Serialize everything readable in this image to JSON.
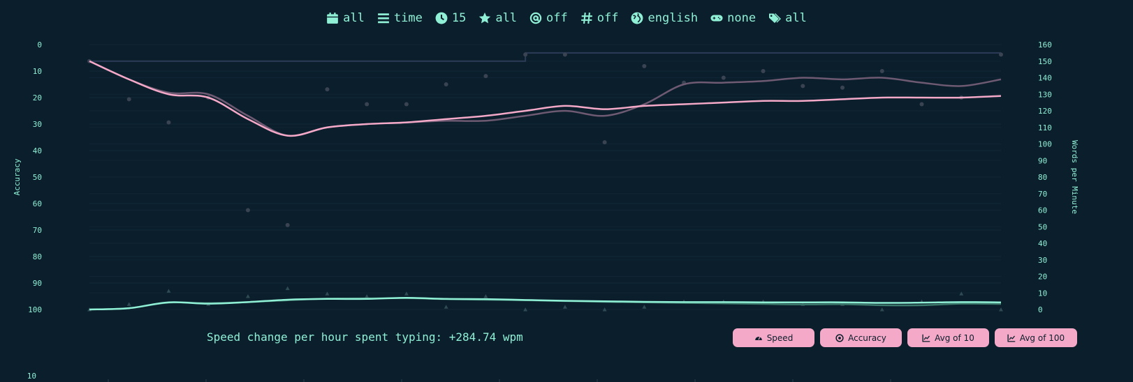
{
  "filters": [
    {
      "icon": "calendar-icon",
      "label": "all"
    },
    {
      "icon": "list-icon",
      "label": "time"
    },
    {
      "icon": "clock-icon",
      "label": "15"
    },
    {
      "icon": "star-icon",
      "label": "all"
    },
    {
      "icon": "at-icon",
      "label": "off"
    },
    {
      "icon": "hash-icon",
      "label": "off"
    },
    {
      "icon": "globe-icon",
      "label": "english"
    },
    {
      "icon": "gamepad-icon",
      "label": "none"
    },
    {
      "icon": "tags-icon",
      "label": "all"
    }
  ],
  "footer": {
    "speed_change": "Speed change per hour spent typing: +284.74 wpm"
  },
  "buttons": {
    "speed": "Speed",
    "accuracy": "Accuracy",
    "avg10": "Avg of 10",
    "avg100": "Avg of 100"
  },
  "second_chart": {
    "first_tick": "10"
  },
  "colors": {
    "accent": "#8ff0d6",
    "pink": "#f5a9c8",
    "background": "#0b1e2b"
  },
  "chart_data": {
    "type": "line",
    "y_left": {
      "label": "Accuracy",
      "range": [
        0,
        100
      ],
      "reversed": true,
      "ticks": [
        0,
        10,
        20,
        30,
        40,
        50,
        60,
        70,
        80,
        90,
        100
      ]
    },
    "y_right": {
      "label": "Words per Minute",
      "range": [
        0,
        160
      ],
      "ticks": [
        0,
        10,
        20,
        30,
        40,
        50,
        60,
        70,
        80,
        90,
        100,
        110,
        120,
        130,
        140,
        150,
        160
      ]
    },
    "grid": true,
    "x": [
      1,
      2,
      3,
      4,
      5,
      6,
      7,
      8,
      9,
      10,
      11,
      12,
      13,
      14,
      15,
      16,
      17,
      18,
      19,
      20,
      21,
      22,
      23,
      24
    ],
    "series": [
      {
        "name": "",
        "role": "wpm_points",
        "axis": "right",
        "values": [
          150,
          127,
          113,
          128,
          60,
          51,
          133,
          124,
          124,
          136,
          141,
          154,
          154,
          101,
          147,
          137,
          140,
          144,
          135,
          134,
          144,
          124,
          128,
          154
        ]
      },
      {
        "name": "",
        "role": "wpm_avg10",
        "axis": "right",
        "values": [
          150,
          139,
          131,
          130,
          117,
          105,
          110,
          112,
          113,
          114,
          114,
          117,
          120,
          117,
          124,
          136,
          137,
          138,
          140,
          139,
          140,
          137,
          135,
          139
        ]
      },
      {
        "name": "",
        "role": "wpm_avg100",
        "axis": "right",
        "values": [
          150,
          139,
          130,
          128,
          115,
          105,
          110,
          112,
          113,
          115,
          117,
          120,
          123,
          121,
          123,
          124,
          125,
          126,
          126,
          127,
          128,
          128,
          128,
          129
        ]
      },
      {
        "name": "",
        "role": "wpm_pb",
        "axis": "right",
        "values": [
          150,
          150,
          150,
          150,
          150,
          150,
          150,
          150,
          150,
          150,
          150,
          155,
          155,
          155,
          155,
          155,
          155,
          155,
          155,
          155,
          155,
          155,
          155,
          155
        ]
      },
      {
        "name": "",
        "role": "acc_points",
        "axis": "left",
        "values": [
          100,
          98,
          93,
          98,
          95,
          92,
          94,
          95,
          94,
          99,
          95,
          100,
          99,
          100,
          99,
          97,
          97,
          97,
          98,
          98,
          100,
          97,
          94,
          100
        ]
      },
      {
        "name": "",
        "role": "acc_avg10",
        "axis": "left",
        "values": [
          100,
          99.5,
          97.4,
          97.6,
          97.2,
          96.5,
          95.9,
          95.8,
          95.7,
          96.1,
          96.3,
          96.5,
          96.8,
          97.1,
          97.3,
          97.5,
          97.7,
          97.9,
          98.1,
          98.0,
          98.4,
          98.4,
          97.8,
          97.9
        ]
      },
      {
        "name": "",
        "role": "acc_avg100",
        "axis": "left",
        "values": [
          100,
          99.5,
          97.3,
          97.8,
          97.2,
          96.3,
          96.0,
          96.0,
          95.6,
          96.0,
          96.1,
          96.4,
          96.7,
          96.9,
          97.1,
          97.2,
          97.2,
          97.3,
          97.3,
          97.3,
          97.5,
          97.4,
          97.2,
          97.3
        ]
      }
    ]
  }
}
